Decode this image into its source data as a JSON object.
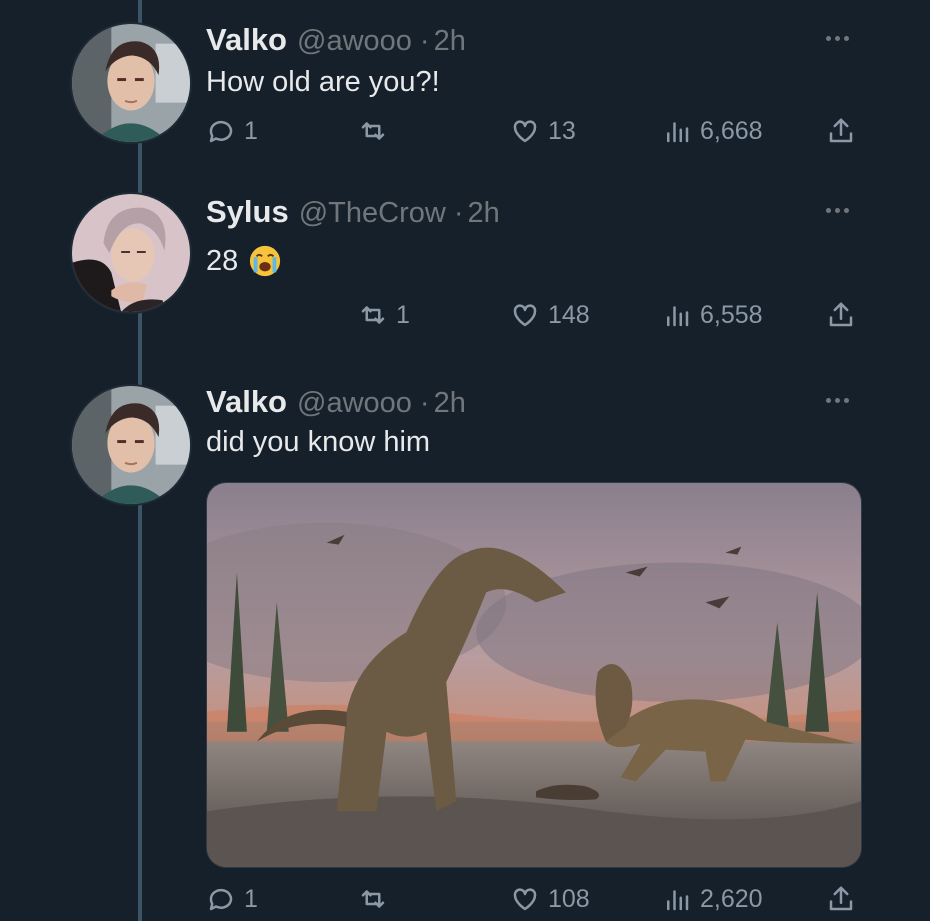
{
  "tweets": [
    {
      "name": "Valko",
      "handle": "@awooo",
      "separator": "·",
      "time": "2h",
      "text": "How old are you?!",
      "replies": "1",
      "retweets": "",
      "likes": "13",
      "views": "6,668"
    },
    {
      "name": "Sylus",
      "handle": "@TheCrow",
      "separator": "·",
      "time": "2h",
      "text": "28",
      "emoji": "loudly-crying-face-icon",
      "replies": "",
      "retweets": "1",
      "likes": "148",
      "views": "6,558"
    },
    {
      "name": "Valko",
      "handle": "@awooo",
      "separator": "·",
      "time": "2h",
      "text": "did you know him",
      "media": "dinosaur-illustration-image",
      "replies": "1",
      "retweets": "",
      "likes": "108",
      "views": "2,620"
    }
  ],
  "colors": {
    "background": "#15202b",
    "thread_line": "#3d5466",
    "muted_text": "#71767b",
    "icon": "#8b98a5"
  }
}
